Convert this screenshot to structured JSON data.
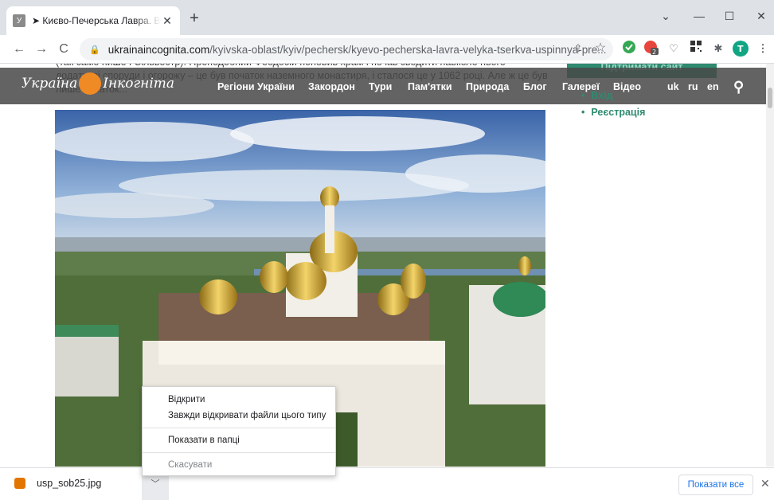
{
  "tab": {
    "favicon": "У",
    "title": "➤ Києво-Печерська Лавра. Велика",
    "close": "✕"
  },
  "newtab": "+",
  "window": {
    "minimize": "—",
    "maximize": "☐",
    "close": "✕",
    "chevron": "⌄"
  },
  "toolbar": {
    "back": "←",
    "forward": "→",
    "reload": "C",
    "lock": "🔒",
    "host": "ukrainaincognita.com",
    "path": "/kyivska-oblast/kyiv/pechersk/kyevo-pecherska-lavra-velyka-tserkva-uspinnya-pre...",
    "share": "⇪",
    "star": "☆",
    "ext_badge": "2",
    "profile": "T"
  },
  "page": {
    "ghost_text": "(так само пише і Сільвестр). Преподобний Феодосій поновив храм і почав зводити навколо нього додаткові споруди і огорожу – це був початок наземного монастиря, і сталося це у 1062 році. Але ж це був лише початок...",
    "logo_left": "Україна",
    "logo_right": "Інкогніта",
    "nav": [
      "Регіони України",
      "Закордон",
      "Тури",
      "Пам'ятки",
      "Природа",
      "Блог",
      "Галереї",
      "Відео"
    ],
    "langs": [
      "uk",
      "ru",
      "en"
    ],
    "support": "Підтримати сайт",
    "side_links": [
      "Вхід",
      "Реєстрація"
    ]
  },
  "download": {
    "filename": "usp_sob25.jpg",
    "show_all": "Показати все",
    "close": "✕"
  },
  "context_menu": {
    "open": "Відкрити",
    "always_open": "Завжди відкривати файли цього типу",
    "show_in_folder": "Показати в папці",
    "cancel": "Скасувати"
  },
  "colors": {
    "accent": "#2e8a70",
    "menu_bar": "#484848",
    "chrome": "#dee1e6"
  }
}
